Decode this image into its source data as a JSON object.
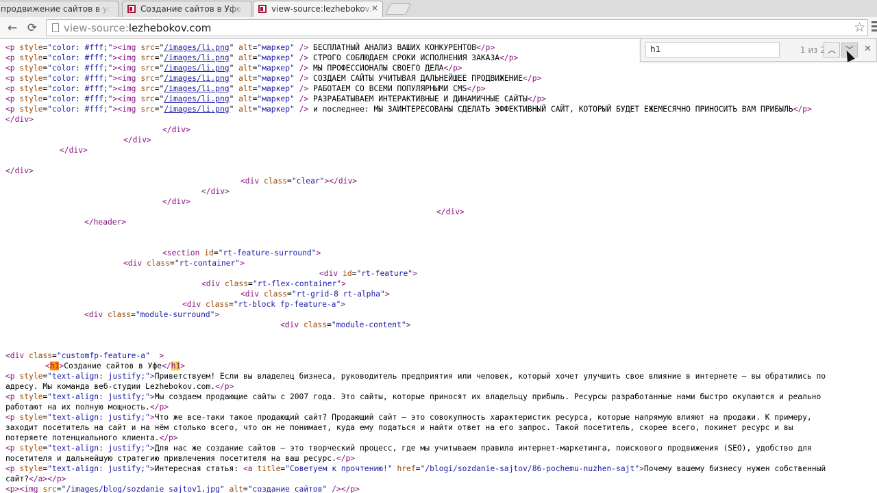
{
  "tabs": [
    {
      "title": "продвижение сайтов в уфе"
    },
    {
      "title": "Создание сайтов в Уфе. Пр"
    },
    {
      "title": "view-source:lezhebokov.co"
    }
  ],
  "toolbar": {
    "back_icon": "←",
    "forward_icon": "→",
    "reload_icon": "⟳",
    "url_scheme": "view-source:",
    "url_host": "lezhebokov.com",
    "star_icon": "☆"
  },
  "findbar": {
    "query": "h1",
    "count": "1 из 2",
    "prev_icon": "︿",
    "next_icon": "﹀",
    "close_icon": "✕"
  },
  "source": {
    "p_open": "<p",
    "p_close": "</p>",
    "style_attr": "style",
    "white_style": "\"color: #fff;\"",
    "img_open": "<img",
    "src_attr": "src",
    "li_src": "/images/li.png",
    "alt_attr": "alt",
    "marker_alt": "\"маркер\"",
    "self_close": " />",
    "list_items": [
      "БЕСПЛАТНЫЙ АНАЛИЗ ВАШИХ КОНКУРЕНТОВ",
      "СТРОГО СОБЛЮДАЕМ СРОКИ ИСПОЛНЕНИЯ ЗАКАЗА",
      "МЫ ПРОФЕССИОНАЛЫ СВОЕГО ДЕЛА",
      "СОЗДАЕМ САЙТЫ УЧИТЫВАЯ ДАЛЬНЕЙШЕЕ ПРОДВИЖЕНИЕ",
      "РАБОТАЕМ СО ВСЕМИ ПОПУЛЯРНЫМИ CMS",
      "РАЗРАБАТЫВАЕМ ИНТЕРАКТИВНЫЕ И ДИНАМИЧНЫЕ САЙТЫ",
      "и последнее: МЫ ЗАИНТЕРЕСОВАНЫ СДЕЛАТЬ ЭФФЕКТИВНЫЙ САЙТ, КОТОРЫЙ БУДЕТ ЕЖЕМЕСЯЧНО ПРИНОСИТЬ ВАМ ПРИБЫЛЬ"
    ],
    "div_close": "</div>",
    "div_open": "<div",
    "class_attr": "class",
    "id_attr": "id",
    "clear_val": "\"clear\"",
    "header_close": "</header>",
    "section_open": "<section",
    "feature_surround_val": "\"rt-feature-surround\"",
    "container_val": "\"rt-container\"",
    "feature_val": "\"rt-feature\"",
    "flex_val": "\"rt-flex-container\"",
    "grid_val": "\"rt-grid-8 rt-alpha\"",
    "block_val": "\"rt-block fp-feature-a\"",
    "module_surround_val": "\"module-surround\"",
    "module_content_val": "\"module-content\"",
    "customfp_val": "\"customfp-feature-a\"",
    "customfp_tail": "  >",
    "lt": "<",
    "gt": ">",
    "lt_slash": "</",
    "eq": "=",
    "h1_tag": "h1",
    "h1_text": "Создание сайтов в Уфе",
    "justify_style": "\"text-align: justify;\"",
    "para1_a": "Приветствуем! Если вы владелец бизнеса, руководитель предприятия или человек, который хочет улучшить свое влияние в интернете – вы обратились по",
    "para1_b": "адресу. Мы команда веб-студии Lezhebokov.com.",
    "para2_a": "Мы создаем продающие сайты с 2007 года. Это сайты, которые приносят их владельцу прибыль. Ресурсы разработанные нами быстро окупаются и реально",
    "para2_b": "работают на их полную мощность.",
    "para3_a": "Что же все-таки такое продающий сайт? Продающий сайт – это совокупность характеристик ресурса, которые напрямую влияют на продажи. К примеру,",
    "para3_b": "заходит посетитель на сайт и на нём столько всего, что он не понимает, куда ему податься и найти ответ на его запрос. Такой посетитель, скорее всего, покинет ресурс и вы",
    "para3_c": "потеряете потенциального клиента.",
    "para4_a": "Для нас же создание сайтов – это творческий процесс, где мы учитываем правила интернет-маркетинга, поискового продвижения (SEO), удобство для",
    "para4_b": "посетителя и дальнейшую стратегию привлечения посетителя на ваш ресурс.",
    "para5_text": "Интересная статья: ",
    "a_open": "<a",
    "title_attr": "title",
    "title_val": "\"Советуем к прочтению!\"",
    "href_attr": "href",
    "href_val": "\"/blogi/sozdanie-sajtov/86-pochemu-nuzhen-sajt\"",
    "link_text_a": "Почему вашему бизнесу нужен собственный",
    "link_text_b": "сайт?",
    "a_close": "</a>",
    "p_img_open": "<p><img",
    "blog_img_src": "\"/images/blog/sozdanie_sajtov1.jpg\"",
    "blog_img_alt": "\"создание сайтов\"",
    "p_img_close": " /></p>"
  }
}
